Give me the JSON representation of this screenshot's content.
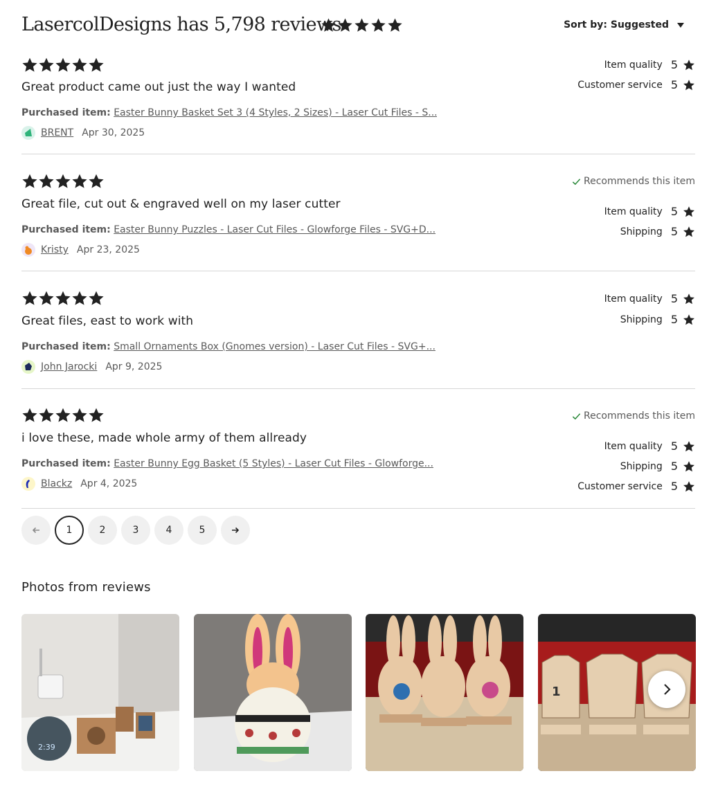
{
  "header": {
    "title": "LasercolDesigns has 5,798 reviews",
    "rating_stars": 5,
    "sort_label": "Sort by: Suggested"
  },
  "reviews": [
    {
      "stars": 5,
      "title": "Great product came out just the way I wanted",
      "purchased_label": "Purchased item:",
      "item": "Easter Bunny Basket Set 3 (4 Styles, 2 Sizes) - Laser Cut Files - S...",
      "author": "BRENT",
      "date": "Apr 30, 2025",
      "recommends": "",
      "ratings": [
        {
          "label": "Item quality",
          "value": "5"
        },
        {
          "label": "Customer service",
          "value": "5"
        }
      ]
    },
    {
      "stars": 5,
      "title": "Great file, cut out & engraved well on my laser cutter",
      "purchased_label": "Purchased item:",
      "item": "Easter Bunny Puzzles - Laser Cut Files - Glowforge Files - SVG+D...",
      "author": "Kristy",
      "date": "Apr 23, 2025",
      "recommends": "Recommends this item",
      "ratings": [
        {
          "label": "Item quality",
          "value": "5"
        },
        {
          "label": "Shipping",
          "value": "5"
        }
      ]
    },
    {
      "stars": 5,
      "title": "Great files, east to work with",
      "purchased_label": "Purchased item:",
      "item": "Small Ornaments Box (Gnomes version) - Laser Cut Files - SVG+...",
      "author": "John Jarocki",
      "date": "Apr 9, 2025",
      "recommends": "",
      "ratings": [
        {
          "label": "Item quality",
          "value": "5"
        },
        {
          "label": "Shipping",
          "value": "5"
        }
      ]
    },
    {
      "stars": 5,
      "title": "i love these, made whole army of them allready",
      "purchased_label": "Purchased item:",
      "item": "Easter Bunny Egg Basket (5 Styles) - Laser Cut Files - Glowforge...",
      "author": "Blackz",
      "date": "Apr 4, 2025",
      "recommends": "Recommends this item",
      "ratings": [
        {
          "label": "Item quality",
          "value": "5"
        },
        {
          "label": "Shipping",
          "value": "5"
        },
        {
          "label": "Customer service",
          "value": "5"
        }
      ]
    }
  ],
  "pagination": {
    "pages": [
      "1",
      "2",
      "3",
      "4",
      "5"
    ],
    "current": "1"
  },
  "photos": {
    "title": "Photos from reviews",
    "count": 4
  },
  "colors": {
    "text": "#222222",
    "muted": "#595959",
    "divider": "#d6d6d6",
    "check": "#258635"
  }
}
